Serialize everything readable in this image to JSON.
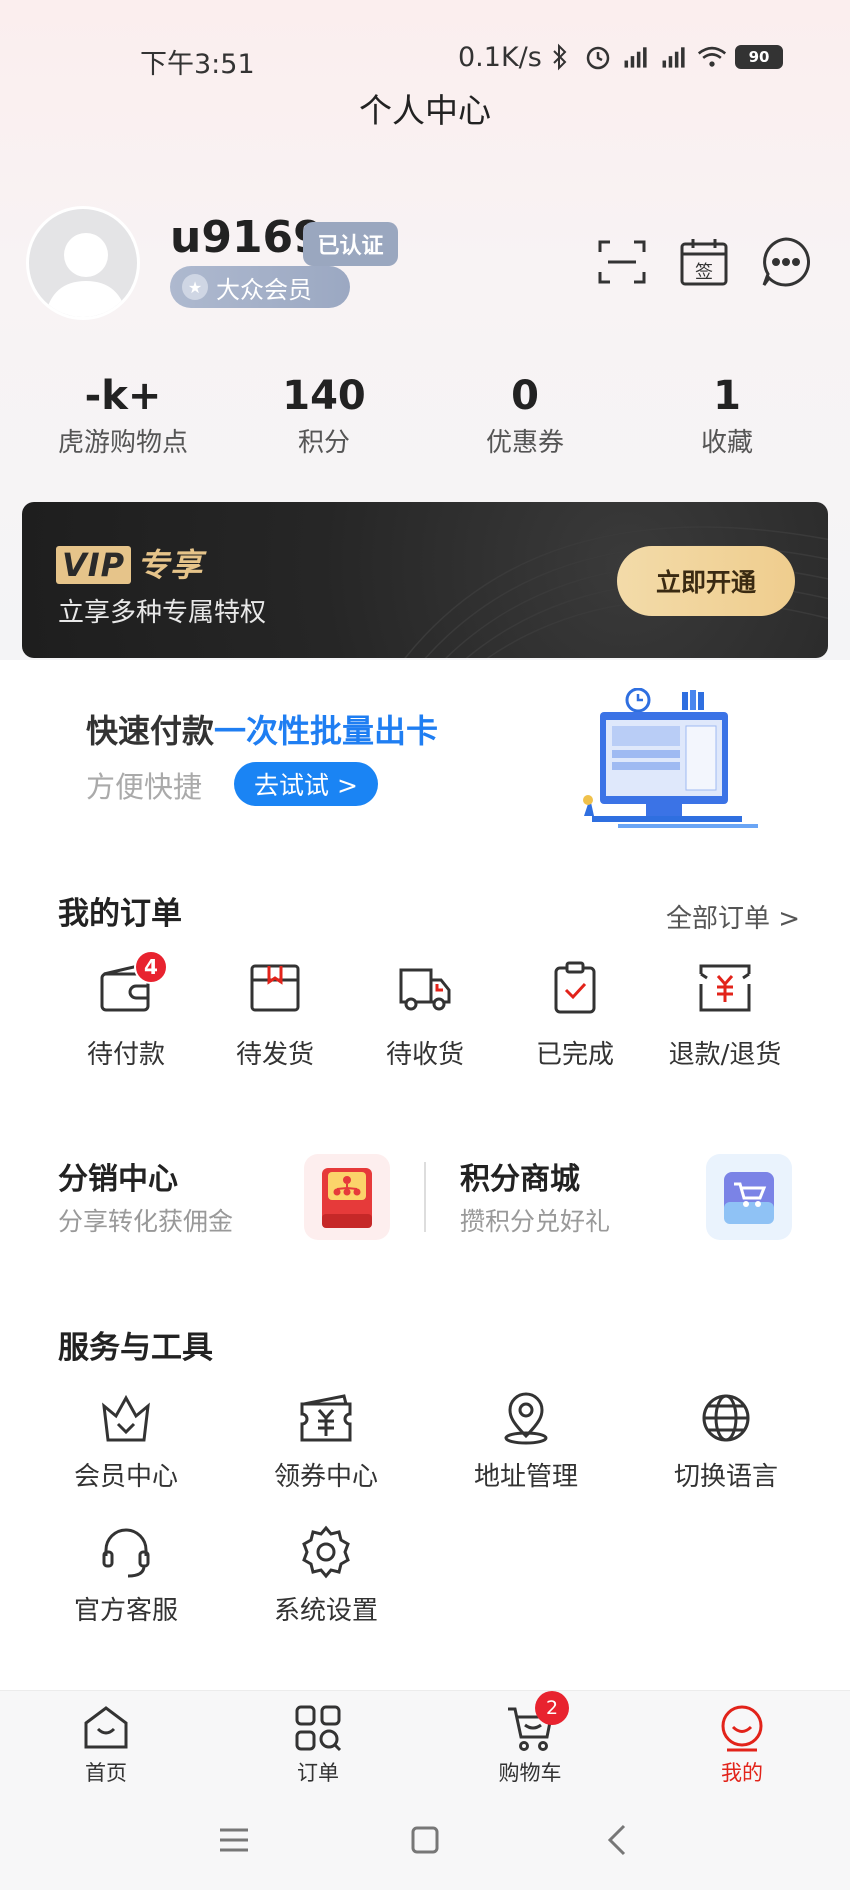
{
  "status": {
    "time": "下午3:51",
    "net_speed": "0.1K/s",
    "battery": "90"
  },
  "page_title": "个人中心",
  "profile": {
    "username": "u9169",
    "verified_label": "已认证",
    "member_level": "大众会员"
  },
  "stats": [
    {
      "value": "-k+",
      "label": "虎游购物点"
    },
    {
      "value": "140",
      "label": "积分"
    },
    {
      "value": "0",
      "label": "优惠券"
    },
    {
      "value": "1",
      "label": "收藏"
    }
  ],
  "vip": {
    "logo_box": "VIP",
    "logo_text": "专享",
    "subtitle": "立享多种专属特权",
    "button": "立即开通"
  },
  "promo": {
    "title_main": "快速付款",
    "title_highlight": "一次性批量出卡",
    "subtitle": "方便快捷",
    "button": "去试试 >"
  },
  "orders": {
    "title": "我的订单",
    "all_link": "全部订单 >",
    "items": [
      {
        "label": "待付款",
        "badge": "4"
      },
      {
        "label": "待发货"
      },
      {
        "label": "待收货"
      },
      {
        "label": "已完成"
      },
      {
        "label": "退款/退货"
      }
    ]
  },
  "promo_cards": [
    {
      "title": "分销中心",
      "subtitle": "分享转化获佣金"
    },
    {
      "title": "积分商城",
      "subtitle": "攒积分兑好礼"
    }
  ],
  "tools": {
    "title": "服务与工具",
    "items": [
      {
        "label": "会员中心",
        "icon": "crown-icon"
      },
      {
        "label": "领券中心",
        "icon": "coupon-icon"
      },
      {
        "label": "地址管理",
        "icon": "location-icon"
      },
      {
        "label": "切换语言",
        "icon": "globe-icon"
      },
      {
        "label": "官方客服",
        "icon": "headset-icon"
      },
      {
        "label": "系统设置",
        "icon": "settings-icon"
      }
    ]
  },
  "tabbar": {
    "items": [
      {
        "label": "首页"
      },
      {
        "label": "订单"
      },
      {
        "label": "购物车",
        "badge": "2"
      },
      {
        "label": "我的"
      }
    ]
  },
  "colors": {
    "accent_red": "#e2231a",
    "accent_blue": "#1f7ef2",
    "vip_gold": "#e6c48a",
    "badge_gray_blue": "#9aa7bf"
  }
}
